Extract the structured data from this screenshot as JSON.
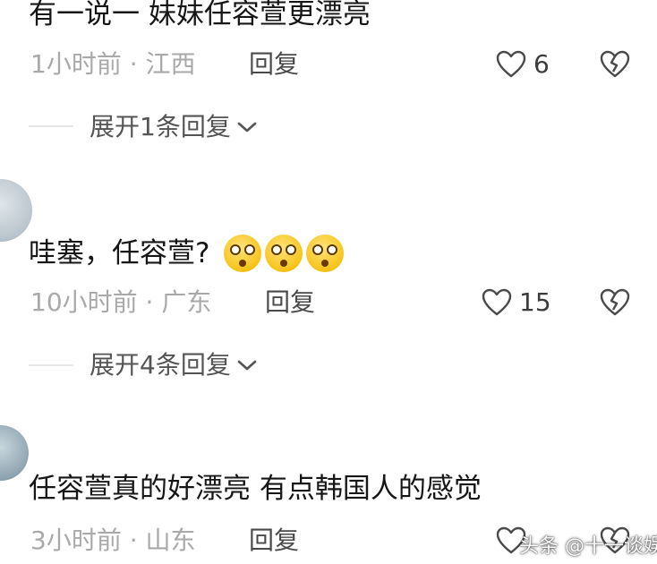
{
  "comments": [
    {
      "text": "有一说一  妹妹任容萱更漂亮",
      "time_location": "1小时前 · 江西",
      "reply_label": "回复",
      "likes": "6",
      "expand_label": "展开1条回复"
    },
    {
      "username": "",
      "text": "哇塞，任容萱?",
      "time_location": "10小时前 · 广东",
      "reply_label": "回复",
      "likes": "15",
      "expand_label": "展开4条回复"
    },
    {
      "username": "",
      "text": "任容萱真的好漂亮 有点韩国人的感觉",
      "time_location": "3小时前 · 山东",
      "reply_label": "回复",
      "likes": ""
    }
  ],
  "watermark": "头条 @十一谈娱",
  "icons": {
    "like": "heart-outline-icon",
    "dislike": "broken-heart-icon",
    "expand": "chevron-down-icon",
    "emoji": "drooling-face-emoji"
  }
}
